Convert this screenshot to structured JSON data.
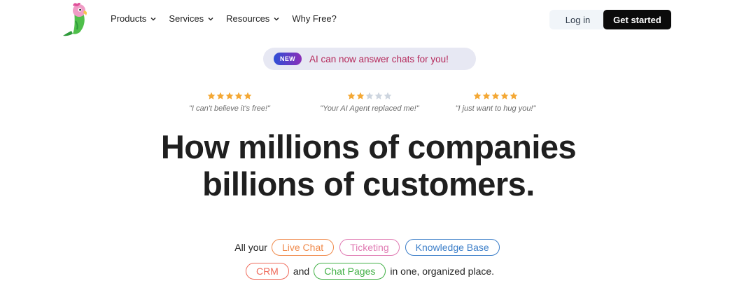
{
  "nav": {
    "items": [
      {
        "label": "Products",
        "has_dropdown": true
      },
      {
        "label": "Services",
        "has_dropdown": true
      },
      {
        "label": "Resources",
        "has_dropdown": true
      },
      {
        "label": "Why Free?",
        "has_dropdown": false
      }
    ],
    "login_label": "Log in",
    "cta_label": "Get started"
  },
  "announcement": {
    "badge": "NEW",
    "text": "AI can now answer chats for you!"
  },
  "reviews": [
    {
      "rating": 5,
      "quote": "\"I can't believe it's free!\""
    },
    {
      "rating": 2,
      "quote": "\"Your AI Agent replaced me!\""
    },
    {
      "rating": 5,
      "quote": "\"I just want to hug you!\""
    }
  ],
  "headline": {
    "line1": "How millions of companies",
    "line2": "billions of customers."
  },
  "features": {
    "prefix": "All your",
    "and": "and",
    "suffix": "in one, organized place.",
    "pills": [
      {
        "label": "Live Chat",
        "color": "#f08a4b"
      },
      {
        "label": "Ticketing",
        "color": "#e07bb3"
      },
      {
        "label": "Knowledge Base",
        "color": "#3d7fc9"
      },
      {
        "label": "CRM",
        "color": "#ef6b5b"
      },
      {
        "label": "Chat Pages",
        "color": "#43b047"
      }
    ]
  },
  "colors": {
    "star_filled": "#f4a835",
    "star_empty": "#cdd5df"
  }
}
